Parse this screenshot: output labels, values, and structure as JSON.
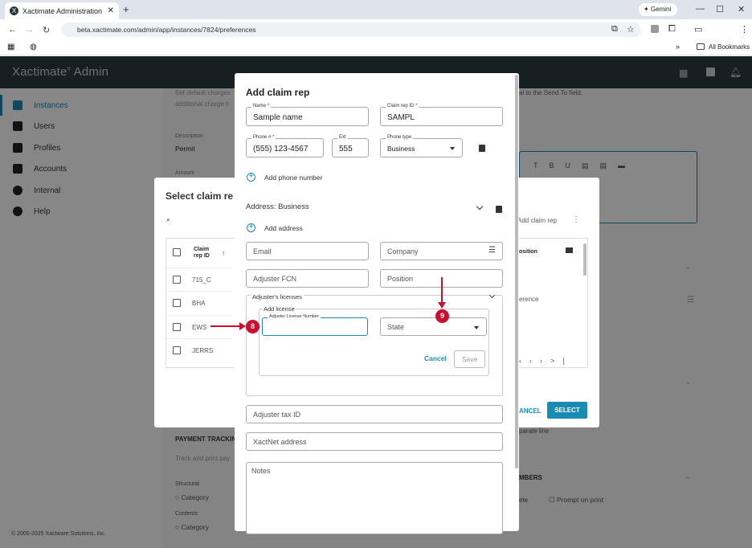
{
  "browser": {
    "tab_title": "Xactimate Administration",
    "url": "beta.xactimate.com/admin/app/instances/7824/preferences",
    "gemini_label": "Gemini",
    "bookmarks_label": "All Bookmarks"
  },
  "app": {
    "brand": "Xactimate",
    "brand_suffix": "Admin",
    "nav": [
      {
        "label": "Instances",
        "icon": "building-icon",
        "active": true
      },
      {
        "label": "Users",
        "icon": "users-icon"
      },
      {
        "label": "Profiles",
        "icon": "profiles-icon"
      },
      {
        "label": "Accounts",
        "icon": "accounts-icon"
      },
      {
        "label": "Internal",
        "icon": "internal-icon"
      },
      {
        "label": "Help",
        "icon": "help-icon"
      }
    ],
    "copyright": "© 2005-2025 Xactware Solutions, Inc."
  },
  "background_page": {
    "desc_text": "Set default charges",
    "desc_text2": "additional charge h",
    "send_to_text": "al to the Send To field.",
    "description_label": "Description",
    "description_value": "Permit",
    "amount_label": "Amount",
    "payment_tracking": "PAYMENT TRACKIN",
    "track_text": "Track and print pay",
    "structural_label": "Structural",
    "contents_label": "Contents",
    "category_label": "Category",
    "separate_line": "parate line",
    "numbers_label": "MBERS",
    "prompt_on_print": "Prompt on print",
    "ete_text": "ete",
    "reference_text": "erence"
  },
  "select_dialog": {
    "title": "Select claim re",
    "col_claim_rep_id": "Claim rep ID",
    "col_position": "osition",
    "add_claim_rep": "Add claim rep",
    "rows": [
      "715_C",
      "BHA",
      "EWS",
      "JERRS"
    ],
    "cancel": "ANCEL",
    "select": "SELECT"
  },
  "add_dialog": {
    "title": "Add claim rep",
    "name_label": "Name",
    "name_value": "Sample name",
    "claim_rep_id_label": "Claim rep ID",
    "claim_rep_id_value": "SAMPL",
    "phone_label": "Phone #",
    "phone_value": "(555) 123-4567",
    "ext_label": "Ext",
    "ext_value": "555",
    "phone_type_label": "Phone type",
    "phone_type_value": "Business",
    "add_phone": "Add phone number",
    "address_title": "Address: Business",
    "add_address": "Add address",
    "email_ph": "Email",
    "company_ph": "Company",
    "adjuster_fcn_ph": "Adjuster FCN",
    "position_ph": "Position",
    "licenses_legend": "Adjuster's licenses",
    "add_license_legend": "Add license",
    "license_number_label": "Adjuster License Number",
    "state_ph": "State",
    "cancel": "Cancel",
    "save": "Save",
    "tax_id_ph": "Adjuster tax ID",
    "xactnet_ph": "XactNet address",
    "notes_ph": "Notes"
  },
  "markers": {
    "m8": "8",
    "m9": "9"
  },
  "colors": {
    "accent": "#1a8bb5",
    "header": "#2f3b42",
    "marker": "#c8102e"
  }
}
